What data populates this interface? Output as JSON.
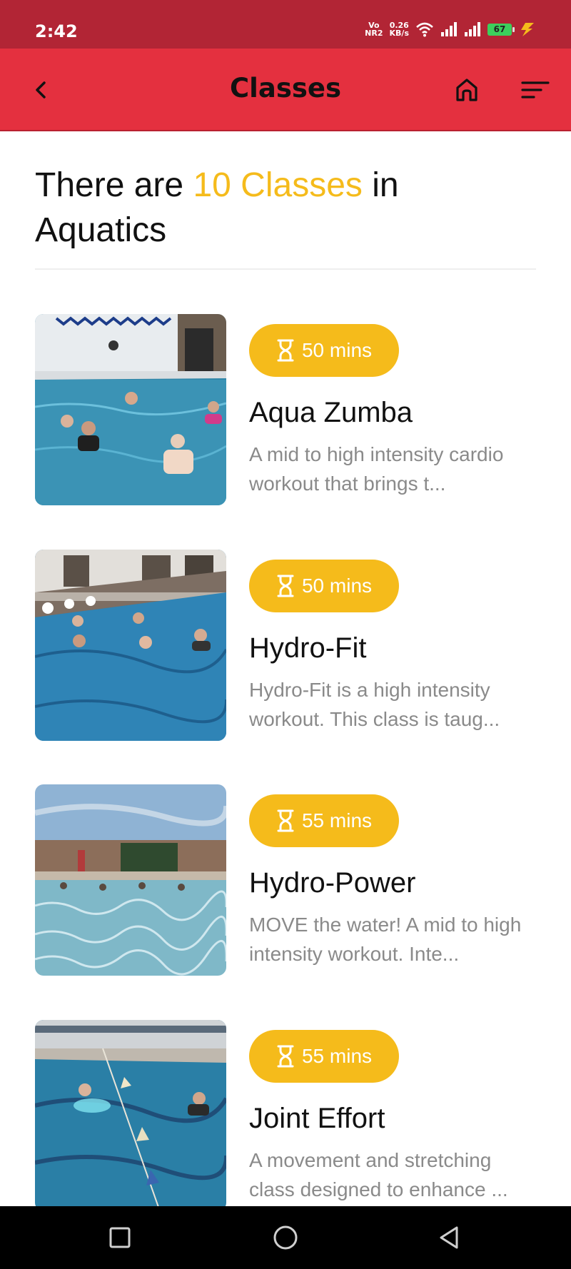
{
  "status": {
    "time": "2:42",
    "network_top": "Vo",
    "network_bottom": "NR2",
    "speed_value": "0.26",
    "speed_unit": "KB/s",
    "battery": "67"
  },
  "appbar": {
    "title": "Classes",
    "back_icon": "chevron-left-icon",
    "home_icon": "home-icon",
    "menu_icon": "sort-menu-icon"
  },
  "heading": {
    "prefix": "There are ",
    "accent": "10 Classes",
    "suffix": " in Aquatics"
  },
  "colors": {
    "status_bar": "#b22535",
    "app_bar": "#e4303f",
    "accent": "#f5bb1b",
    "description": "#8a8a8a"
  },
  "classes": [
    {
      "duration": "50 mins",
      "name": "Aqua Zumba",
      "description": "A mid to high intensity cardio workout that brings t..."
    },
    {
      "duration": "50 mins",
      "name": "Hydro-Fit",
      "description": "Hydro-Fit is a high intensity workout. This class is taug..."
    },
    {
      "duration": "55 mins",
      "name": "Hydro-Power",
      "description": "MOVE the water! A mid to high intensity workout. Inte..."
    },
    {
      "duration": "55 mins",
      "name": "Joint Effort",
      "description": "A movement and stretching class designed to enhance ..."
    }
  ],
  "navbar": {
    "recents_icon": "square-icon",
    "home_icon": "circle-icon",
    "back_icon": "triangle-back-icon"
  }
}
